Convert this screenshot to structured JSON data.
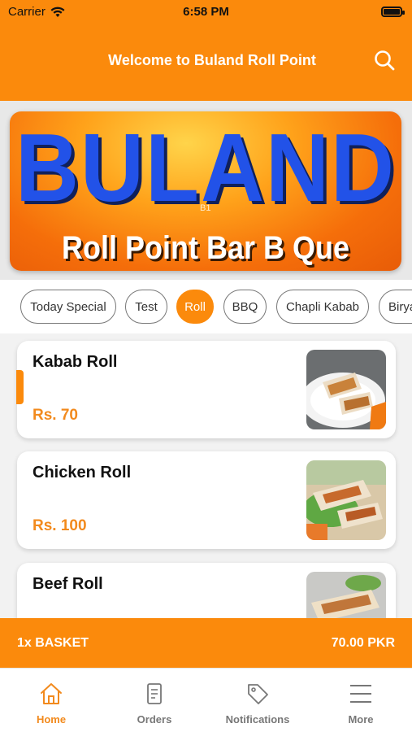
{
  "status_bar": {
    "carrier": "Carrier",
    "time": "6:58 PM"
  },
  "header": {
    "title": "Welcome to Buland Roll Point",
    "search_icon": "search-icon"
  },
  "banner": {
    "brand": "BULAND",
    "subtitle": "Roll Point Bar B Que",
    "tag": "B1"
  },
  "categories": [
    {
      "label": "Today Special",
      "active": false
    },
    {
      "label": "Test",
      "active": false
    },
    {
      "label": "Roll",
      "active": true
    },
    {
      "label": "BBQ",
      "active": false
    },
    {
      "label": "Chapli Kabab",
      "active": false
    },
    {
      "label": "Biryani",
      "active": false
    }
  ],
  "items": [
    {
      "name": "Kabab Roll",
      "price": "Rs. 70"
    },
    {
      "name": "Chicken Roll",
      "price": "Rs. 100"
    },
    {
      "name": "Beef Roll",
      "price": ""
    }
  ],
  "basket": {
    "count_label": "1x BASKET",
    "total": "70.00 PKR"
  },
  "tabs": [
    {
      "label": "Home",
      "icon": "home-icon",
      "active": true
    },
    {
      "label": "Orders",
      "icon": "orders-icon",
      "active": false
    },
    {
      "label": "Notifications",
      "icon": "tag-icon",
      "active": false
    },
    {
      "label": "More",
      "icon": "menu-icon",
      "active": false
    }
  ],
  "colors": {
    "accent": "#fb8a0c",
    "price": "#f28a1d",
    "banner_text": "#2252e8"
  }
}
